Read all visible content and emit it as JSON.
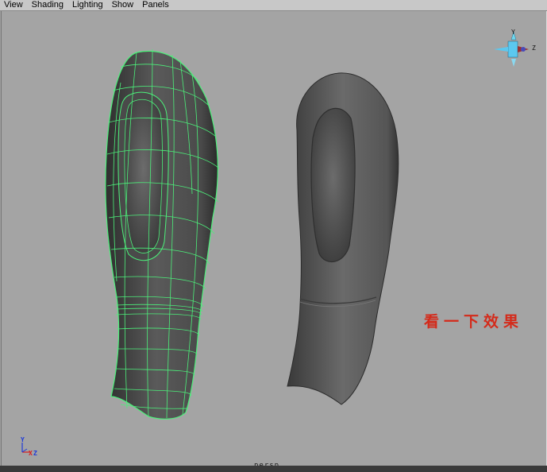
{
  "menubar": {
    "items": [
      "View",
      "Shading",
      "Lighting",
      "Show",
      "Panels"
    ]
  },
  "viewport": {
    "camera_label": "persp",
    "overlay_text": "看一下效果",
    "view_cube": {
      "y_label": "Y",
      "z_label": "Z"
    },
    "axis_indicator": {
      "y_label": "Y",
      "x_label": "X",
      "z_label": "Z"
    }
  },
  "colors": {
    "viewport_bg": "#a4a4a4",
    "wire_color": "#4cf07a",
    "overlay_text": "#d42a1a"
  }
}
